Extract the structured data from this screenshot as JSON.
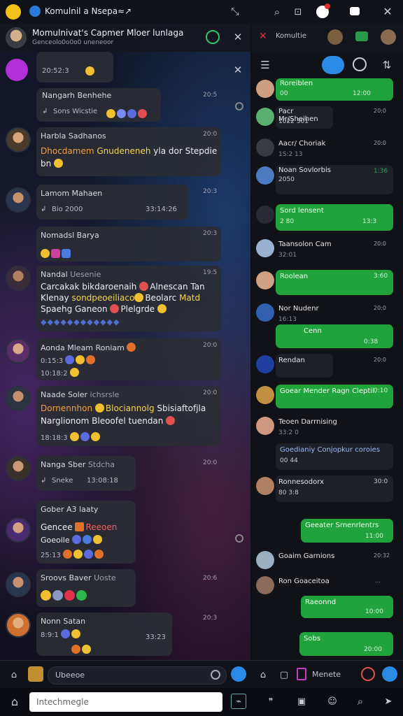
{
  "topbar": {
    "app_title": "Komulnil a Nsepa",
    "suffix_mark": "≈↗"
  },
  "left": {
    "chat_title": "Momulnivat's Capmer Mloer lunlaga",
    "chat_subtitle": "Genceolo0o0o0 uneneoor",
    "first_row_time": "20:52:3",
    "messages": [
      {
        "name": "Nangarh Benhehe",
        "meta": "Sons Wicstie",
        "time": "20:5"
      },
      {
        "name": "Harbla Sadhanos",
        "text1": "Dhocdamem",
        "text1b": "Gnudeneneh",
        "text1c": "yla dor Stepdie",
        "text2": "bn",
        "time": "20:0"
      },
      {
        "name": "Lamom Mahaen",
        "meta": "Bio 2000",
        "meta2": "33:14:26",
        "time": "20:3"
      },
      {
        "name": "Nomadsl Barya",
        "time": "20:3"
      },
      {
        "name": "Nandal",
        "name2": "Uesenie",
        "text1": "Carcakak bikdaroenaih",
        "text1b": "Alnescan Tan",
        "text2": "Klenay",
        "text2b": "sondpeoeiliaco",
        "text2c": "Beolarc",
        "text2d": "Matd",
        "text3": "Spaehg Ganeon",
        "text3b": "Plelgrde",
        "time": "19:5"
      },
      {
        "name": "Aonda Mleam Roniam",
        "meta": "0:15:3",
        "meta2": "10:18:2",
        "time": "20:0"
      },
      {
        "name": "Naade Soler",
        "name2": "ichsrsle",
        "text1": "Dornennhon",
        "text1b": "Blociannolg",
        "text1c": "Sbisiaftofjla",
        "text2": "Narglionom Bleoofel tuendan",
        "meta": "18:18:3",
        "time": "20:0"
      },
      {
        "name": "Nanga Sber",
        "name2": "Stdcha",
        "meta": "Sneke",
        "meta2": "13:08:18",
        "time": "20:0"
      },
      {
        "name": "Gober A3 laaty",
        "text1": "Gencee",
        "text1b": "Reeoen",
        "text2": "Goeoile",
        "meta": "25:13",
        "time": ""
      },
      {
        "name": "Sroovs Baver",
        "name2": "Uoste",
        "time": "20:6"
      },
      {
        "name": "Nonn Satan",
        "meta": "8:9:1",
        "meta2": "33:23",
        "time": "20:3"
      }
    ]
  },
  "right": {
    "header_title": "Komultie",
    "rows": [
      {
        "name": "Roreiblen",
        "sub": "00",
        "time": "12:00",
        "style": "g"
      },
      {
        "name": "Pacr Mr/Sheihen",
        "sub": "1022 301",
        "time": "20:0",
        "style": "d"
      },
      {
        "name": "Aacr/ Choriak",
        "sub": "1S:2 13",
        "time": "20:0",
        "style": "d"
      },
      {
        "name": "Noan Sovlorbis",
        "sub": "2050",
        "time": "1:36",
        "style": "d"
      },
      {
        "name": "Sord lensent",
        "sub": "2 80",
        "time": "13:3",
        "style": "g"
      },
      {
        "name": "Taansolon Cam",
        "sub": "32:01",
        "time": "20:0",
        "style": "d"
      },
      {
        "name": "Roolean",
        "sub": "",
        "time": "3:60",
        "style": "g"
      },
      {
        "name": "Nor Nudenr",
        "sub": "16:13",
        "time": "20:0",
        "style": "d"
      },
      {
        "name": "Cenn",
        "sub": "",
        "time": "0:38",
        "style": "g"
      },
      {
        "name": "Rendan",
        "sub": "",
        "time": "20:0",
        "style": "d"
      },
      {
        "name": "Goear Mender Ragn Cleptil.",
        "sub": "",
        "time": "0:10",
        "style": "g"
      },
      {
        "name": "Teoen Darrnising",
        "sub": "33:2 0",
        "time": "",
        "style": "d"
      },
      {
        "name": "Goedianiy Conjopkur coroies",
        "sub": "00 44",
        "time": "",
        "style": "d"
      },
      {
        "name": "Ronnesodorx",
        "sub": "80 3:8",
        "time": "30:0",
        "style": "d"
      },
      {
        "name": "Geeater Srnenrlentrs",
        "sub": "",
        "time": "11:00",
        "style": "g"
      },
      {
        "name": "Goaim Garnions",
        "sub": "",
        "time": "20:32",
        "style": "d"
      },
      {
        "name": "Ron Goaceitoa",
        "sub": "",
        "time": "...",
        "style": "d"
      },
      {
        "name": "Raeonnd",
        "sub": "",
        "time": "10:00",
        "style": "g"
      },
      {
        "name": "Sobs",
        "sub": "",
        "time": "20:00",
        "style": "g"
      }
    ]
  },
  "inputbar": {
    "left_placeholder": "Ubeeoe",
    "right_placeholder": "Menete"
  },
  "navbar": {
    "compose_placeholder": "Intechmegle"
  }
}
